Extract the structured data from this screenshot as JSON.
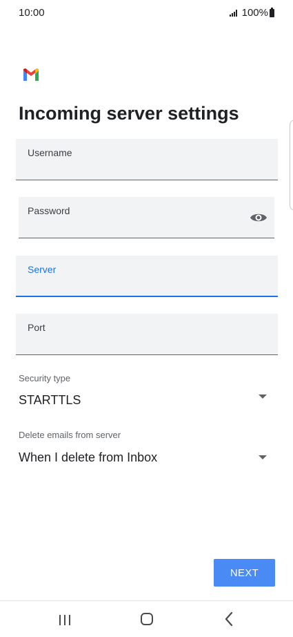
{
  "status_bar": {
    "time": "10:00",
    "battery": "100%"
  },
  "app": {
    "logo": "gmail-logo"
  },
  "page": {
    "title": "Incoming server settings"
  },
  "fields": {
    "username": {
      "label": "Username",
      "value": ""
    },
    "password": {
      "label": "Password",
      "value": ""
    },
    "server": {
      "label": "Server",
      "value": ""
    },
    "port": {
      "label": "Port",
      "value": ""
    }
  },
  "security_type": {
    "label": "Security type",
    "value": "STARTTLS"
  },
  "delete_emails": {
    "label": "Delete emails from server",
    "value": "When I delete from Inbox"
  },
  "actions": {
    "next_label": "NEXT"
  },
  "nav_bar": {
    "recents_icon": "recents-icon",
    "home_icon": "home-icon",
    "back_icon": "back-icon"
  },
  "colors": {
    "accent": "#1a73e8",
    "button": "#4a8af4",
    "field_bg": "#f1f3f4"
  }
}
